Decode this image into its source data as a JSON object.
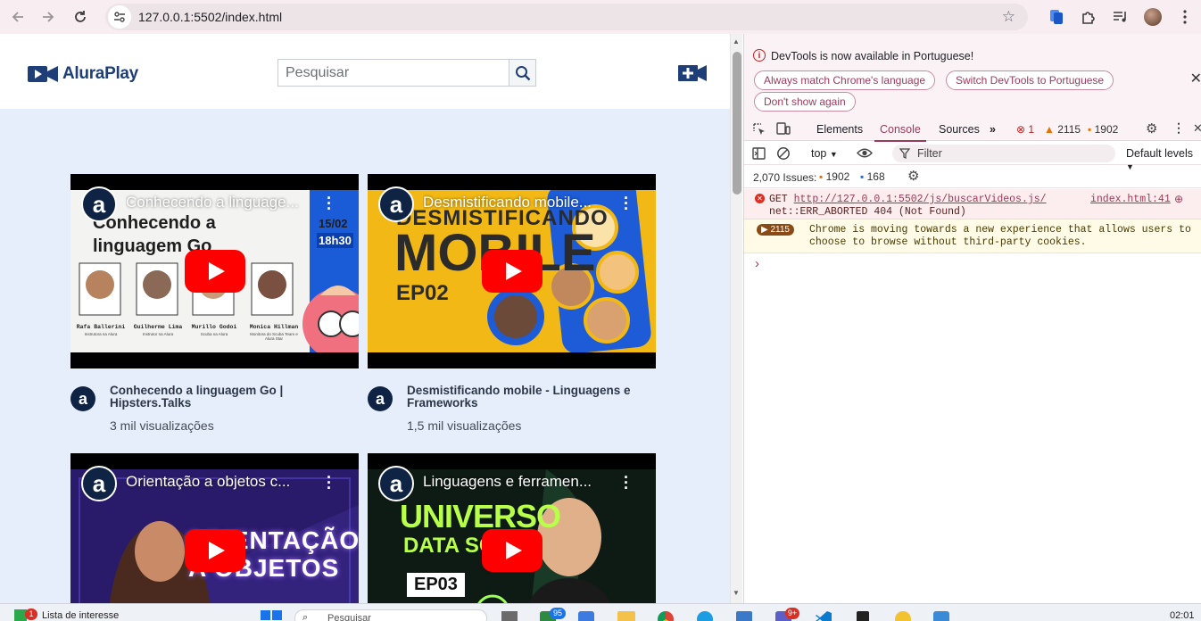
{
  "browser": {
    "url": "127.0.0.1:5502/index.html"
  },
  "site": {
    "logo_text": "AluraPlay",
    "search_placeholder": "Pesquisar"
  },
  "videos": [
    {
      "overlay_title": "Conhecendo a linguage...",
      "title": "Conhecendo a linguagem Go | Hipsters.Talks",
      "views": "3 mil visualizações",
      "thumb_heading": "Conhecendo a\nlinguagem Go",
      "thumb_date": "15/02",
      "thumb_time": "18h30",
      "people": [
        {
          "name": "Rafa Ballerini",
          "role": "Instrutora na Alura"
        },
        {
          "name": "Guilherme Lima",
          "role": "Instrutor na Alura"
        },
        {
          "name": "Murillo Godoi",
          "role": "Scuba na Alura"
        },
        {
          "name": "Monica Hillman",
          "role": "Monitora do Scuba Team e Alura Star"
        }
      ]
    },
    {
      "overlay_title": "Desmistificando mobile...",
      "title": "Desmistificando mobile - Linguagens e Frameworks",
      "views": "1,5 mil visualizações",
      "thumb_word1": "DESMISTIFICANDO",
      "thumb_word2": "MOBILE",
      "thumb_word3": "EP02"
    },
    {
      "overlay_title": "Orientação a objetos c...",
      "thumb_word1": "ORIENTAÇÃO",
      "thumb_word2": "A OBJETOS"
    },
    {
      "overlay_title": "Linguagens e ferramen...",
      "thumb_word1": "UNIVERSO",
      "thumb_word2": "DATA SC",
      "thumb_word3": "EP03"
    }
  ],
  "devtools": {
    "notice": "DevTools is now available in Portuguese!",
    "btn_match": "Always match Chrome's language",
    "btn_switch": "Switch DevTools to Portuguese",
    "btn_dont": "Don't show again",
    "tabs": [
      "Elements",
      "Console",
      "Sources"
    ],
    "error_count": "1",
    "warn_count": "2115",
    "info_count": "1902",
    "context": "top",
    "filter_placeholder": "Filter",
    "levels": "Default levels",
    "issues_label": "2,070 Issues:",
    "issues_warn": "1902",
    "issues_info": "168",
    "error_line1": "GET ",
    "error_url": "http://127.0.0.1:5502/js/buscarVideos.js/",
    "error_line2": "net::ERR_ABORTED 404 (Not Found)",
    "error_source": "index.html:41",
    "warn_badge": "2115",
    "warn_line1": "Chrome is moving towards a new experience that allows users to",
    "warn_line2": "choose to browse without third-party cookies.",
    "prompt": "›"
  },
  "taskbar": {
    "news_badge": "1",
    "news_label": "Lista de interesse",
    "search_label": "Pesquisar",
    "store_badge": "95",
    "teams_badge": "9+",
    "clock": "02:01"
  },
  "colors": {
    "brand_navy": "#1d3e76",
    "page_bg": "#e6eefc",
    "youtube_red": "#ff0000",
    "devtools_accent": "#9c3a5a"
  }
}
